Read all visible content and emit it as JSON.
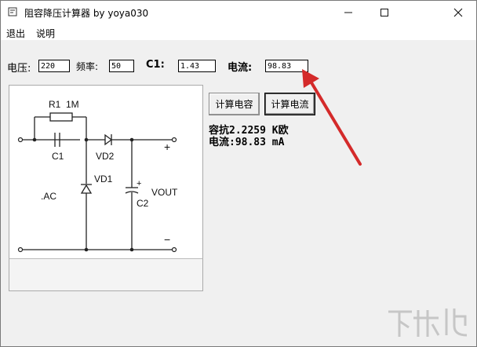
{
  "window": {
    "title": "阻容降压计算器 by yoya030"
  },
  "menu": {
    "items": [
      "退出",
      "说明"
    ]
  },
  "inputs": {
    "voltage": {
      "label": "电压:",
      "value": "220"
    },
    "frequency": {
      "label": "频率:",
      "value": "50"
    },
    "c1": {
      "label": "C1:",
      "value": "1.43"
    },
    "current": {
      "label": "电流:",
      "value": "98.83"
    }
  },
  "buttons": {
    "calc_capacitance": "计算电容",
    "calc_current": "计算电流"
  },
  "results": {
    "reactance": "容抗2.2259 K欧",
    "current": "电流:98.83 mA"
  },
  "circuit": {
    "r1": "R1",
    "r1_value": "1M",
    "c1": "C1",
    "vd2": "VD2",
    "vd1": "VD1",
    "c2": "C2",
    "vout": "VOUT",
    "ac": ".AC",
    "plus": "+",
    "minus": "−",
    "cap_plus": "+"
  },
  "annotation": {
    "arrow_color": "#d42a2a"
  },
  "watermark": {
    "text": "下载吧"
  }
}
